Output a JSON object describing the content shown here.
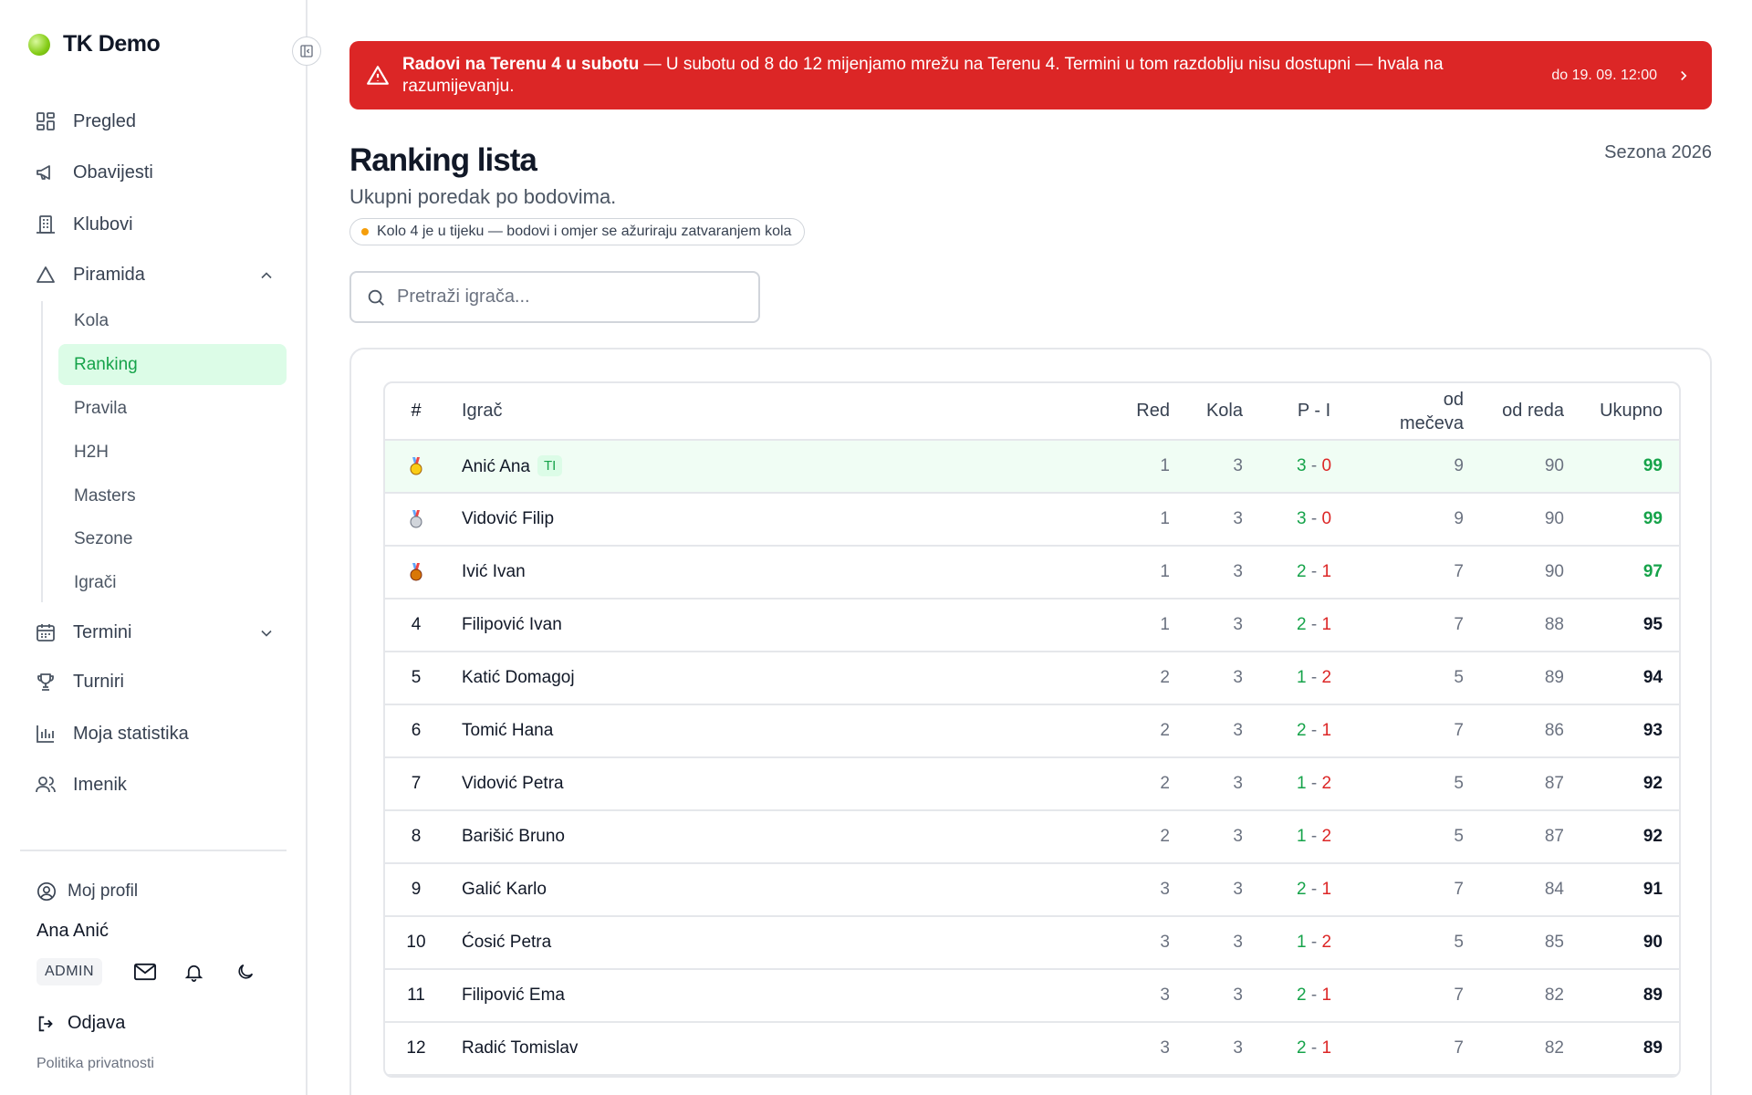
{
  "app": {
    "name": "TK Demo"
  },
  "sidebar": {
    "nav": {
      "pregled": "Pregled",
      "obavijesti": "Obavijesti",
      "klubovi": "Klubovi",
      "piramida": "Piramida",
      "termini": "Termini",
      "turniri": "Turniri",
      "statistika": "Moja statistika",
      "imenik": "Imenik"
    },
    "piramida_sub": {
      "kola": "Kola",
      "ranking": "Ranking",
      "pravila": "Pravila",
      "h2h": "H2H",
      "masters": "Masters",
      "sezone": "Sezone",
      "igraci": "Igrači"
    },
    "profile_link": "Moj profil",
    "user_name": "Ana Anić",
    "role": "ADMIN",
    "logout": "Odjava",
    "privacy": "Politika privatnosti"
  },
  "alert": {
    "title": "Radovi na Terenu 4 u subotu",
    "message": " — U subotu od 8 do 12 mijenjamo mrežu na Terenu 4. Termini u tom razdoblju nisu dostupni — hvala na razumijevanju.",
    "until": "do 19. 09. 12:00",
    "color": "#dc2626"
  },
  "page": {
    "title": "Ranking lista",
    "subtitle": "Ukupni poredak po bodovima.",
    "season": "Sezona 2026",
    "round_status": "Kolo 4 je u tijeku — bodovi i omjer se ažuriraju zatvaranjem kola"
  },
  "search": {
    "placeholder": "Pretraži igrača..."
  },
  "table": {
    "headers": {
      "rank": "#",
      "player": "Igrač",
      "row": "Red",
      "rounds": "Kola",
      "wl": "P - I",
      "from_matches_1": "od",
      "from_matches_2": "mečeva",
      "from_row": "od reda",
      "total": "Ukupno"
    },
    "you_badge": "TI",
    "rows": [
      {
        "rank": "",
        "medal": "gold",
        "name": "Anić Ana",
        "you": true,
        "red": "1",
        "kola": "3",
        "p": "3",
        "i": "0",
        "od_meceva": "9",
        "od_reda": "90",
        "ukupno": "99",
        "top": true
      },
      {
        "rank": "",
        "medal": "silver",
        "name": "Vidović Filip",
        "you": false,
        "red": "1",
        "kola": "3",
        "p": "3",
        "i": "0",
        "od_meceva": "9",
        "od_reda": "90",
        "ukupno": "99",
        "top": true
      },
      {
        "rank": "",
        "medal": "bronze",
        "name": "Ivić Ivan",
        "you": false,
        "red": "1",
        "kola": "3",
        "p": "2",
        "i": "1",
        "od_meceva": "7",
        "od_reda": "90",
        "ukupno": "97",
        "top": true
      },
      {
        "rank": "4",
        "medal": "",
        "name": "Filipović Ivan",
        "you": false,
        "red": "1",
        "kola": "3",
        "p": "2",
        "i": "1",
        "od_meceva": "7",
        "od_reda": "88",
        "ukupno": "95",
        "top": false
      },
      {
        "rank": "5",
        "medal": "",
        "name": "Katić Domagoj",
        "you": false,
        "red": "2",
        "kola": "3",
        "p": "1",
        "i": "2",
        "od_meceva": "5",
        "od_reda": "89",
        "ukupno": "94",
        "top": false
      },
      {
        "rank": "6",
        "medal": "",
        "name": "Tomić Hana",
        "you": false,
        "red": "2",
        "kola": "3",
        "p": "2",
        "i": "1",
        "od_meceva": "7",
        "od_reda": "86",
        "ukupno": "93",
        "top": false
      },
      {
        "rank": "7",
        "medal": "",
        "name": "Vidović Petra",
        "you": false,
        "red": "2",
        "kola": "3",
        "p": "1",
        "i": "2",
        "od_meceva": "5",
        "od_reda": "87",
        "ukupno": "92",
        "top": false
      },
      {
        "rank": "8",
        "medal": "",
        "name": "Barišić Bruno",
        "you": false,
        "red": "2",
        "kola": "3",
        "p": "1",
        "i": "2",
        "od_meceva": "5",
        "od_reda": "87",
        "ukupno": "92",
        "top": false
      },
      {
        "rank": "9",
        "medal": "",
        "name": "Galić Karlo",
        "you": false,
        "red": "3",
        "kola": "3",
        "p": "2",
        "i": "1",
        "od_meceva": "7",
        "od_reda": "84",
        "ukupno": "91",
        "top": false
      },
      {
        "rank": "10",
        "medal": "",
        "name": "Ćosić Petra",
        "you": false,
        "red": "3",
        "kola": "3",
        "p": "1",
        "i": "2",
        "od_meceva": "5",
        "od_reda": "85",
        "ukupno": "90",
        "top": false
      },
      {
        "rank": "11",
        "medal": "",
        "name": "Filipović Ema",
        "you": false,
        "red": "3",
        "kola": "3",
        "p": "2",
        "i": "1",
        "od_meceva": "7",
        "od_reda": "82",
        "ukupno": "89",
        "top": false
      },
      {
        "rank": "12",
        "medal": "",
        "name": "Radić Tomislav",
        "you": false,
        "red": "3",
        "kola": "3",
        "p": "2",
        "i": "1",
        "od_meceva": "7",
        "od_reda": "82",
        "ukupno": "89",
        "top": false
      }
    ]
  },
  "colors": {
    "accent": "#16a34a",
    "accent_bg": "#dcfce7",
    "loss": "#dc2626",
    "pending": "#f59e0b"
  }
}
